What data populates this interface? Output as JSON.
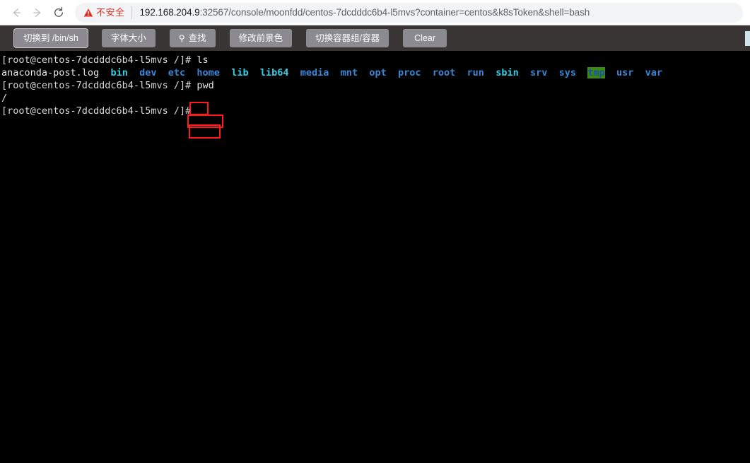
{
  "browser": {
    "back_icon": "arrow-left-icon",
    "forward_icon": "arrow-right-icon",
    "reload_icon": "reload-icon",
    "security_label": "不安全",
    "security_icon": "warning-triangle-icon",
    "url_host": "192.168.204.9",
    "url_rest": ":32567/console/moonfdd/centos-7dcdddc6b4-l5mvs?container=centos&k8sToken&shell=bash",
    "colors": {
      "warning": "#d93025",
      "omnibox_bg": "#f1f3f4",
      "host_text": "#202124",
      "path_text": "#5f6368"
    }
  },
  "toolbar": {
    "buttons": [
      {
        "label": "切换到 /bin/sh",
        "name": "switch-shell-button",
        "focused": true
      },
      {
        "label": "字体大小",
        "name": "font-size-button",
        "focused": false
      },
      {
        "label": "查找",
        "name": "find-button",
        "icon": "search-icon",
        "focused": false
      },
      {
        "label": "修改前景色",
        "name": "change-foreground-color-button",
        "focused": false
      },
      {
        "label": "切换容器组/容器",
        "name": "switch-pod-container-button",
        "focused": false
      },
      {
        "label": "Clear",
        "name": "clear-button",
        "focused": false
      }
    ],
    "colors": {
      "bar_bg": "#393534",
      "button_bg": "#8a8a90",
      "button_text": "#ffffff"
    }
  },
  "terminal": {
    "prompt": "[root@centos-7dcdddc6b4-l5mvs /]#",
    "lines": [
      {
        "type": "prompt-cmd",
        "prompt": "[root@centos-7dcdddc6b4-l5mvs /]# ",
        "command": "ls"
      },
      {
        "type": "ls-output",
        "entries": [
          {
            "name": "anaconda-post.log",
            "kind": "file"
          },
          {
            "name": "bin",
            "kind": "link"
          },
          {
            "name": "dev",
            "kind": "dir"
          },
          {
            "name": "etc",
            "kind": "dir"
          },
          {
            "name": "home",
            "kind": "dir"
          },
          {
            "name": "lib",
            "kind": "link"
          },
          {
            "name": "lib64",
            "kind": "link"
          },
          {
            "name": "media",
            "kind": "dir"
          },
          {
            "name": "mnt",
            "kind": "dir"
          },
          {
            "name": "opt",
            "kind": "dir"
          },
          {
            "name": "proc",
            "kind": "dir"
          },
          {
            "name": "root",
            "kind": "dir"
          },
          {
            "name": "run",
            "kind": "dir"
          },
          {
            "name": "sbin",
            "kind": "link"
          },
          {
            "name": "srv",
            "kind": "dir"
          },
          {
            "name": "sys",
            "kind": "dir"
          },
          {
            "name": "tmp",
            "kind": "sticky"
          },
          {
            "name": "usr",
            "kind": "dir"
          },
          {
            "name": "var",
            "kind": "dir"
          }
        ]
      },
      {
        "type": "prompt-cmd",
        "prompt": "[root@centos-7dcdddc6b4-l5mvs /]# ",
        "command": "pwd"
      },
      {
        "type": "output",
        "text": "/"
      },
      {
        "type": "prompt-cmd",
        "prompt": "[root@centos-7dcdddc6b4-l5mvs /]#",
        "command": ""
      }
    ],
    "colors": {
      "bg": "#000000",
      "text": "#e6e6e6",
      "dir": "#3a86d4",
      "link": "#2fd0e6",
      "sticky_bg": "#3a8a10",
      "sticky_fg": "#1b4fa8"
    }
  },
  "annotations": [
    {
      "name": "highlight-ls-command",
      "target": "ls"
    },
    {
      "name": "highlight-home-entry",
      "target": "home"
    },
    {
      "name": "highlight-pwd-command",
      "target": "pwd"
    }
  ]
}
